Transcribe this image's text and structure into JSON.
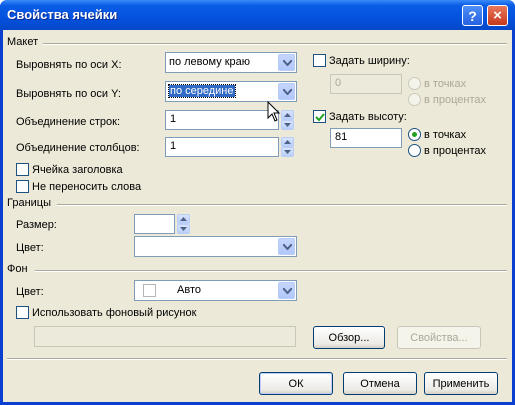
{
  "window": {
    "title": "Свойства ячейки",
    "help_label": "?",
    "close_label": "×"
  },
  "layout_section": {
    "title": "Макет",
    "align_x_label": "Выровнять по оси X:",
    "align_x_value": "по левому краю",
    "align_y_label": "Выровнять по оси Y:",
    "align_y_value": "по середине",
    "rowspan_label": "Объединение строк:",
    "rowspan_value": "1",
    "colspan_label": "Объединение столбцов:",
    "colspan_value": "1",
    "header_cell_label": "Ячейка заголовка",
    "header_cell_checked": false,
    "nowrap_label": "Не переносить слова",
    "nowrap_checked": false,
    "set_width_label": "Задать ширину:",
    "set_width_checked": false,
    "width_value": "0",
    "width_unit_points": "в точках",
    "width_unit_percent": "в процентах",
    "set_height_label": "Задать высоту:",
    "set_height_checked": true,
    "height_value": "81",
    "height_unit_points": "в точках",
    "height_unit_percent": "в процентах",
    "height_unit_selected": "points"
  },
  "borders_section": {
    "title": "Границы",
    "size_label": "Размер:",
    "size_value": "",
    "color_label": "Цвет:",
    "color_value": ""
  },
  "background_section": {
    "title": "Фон",
    "color_label": "Цвет:",
    "color_value": "Авто",
    "use_image_label": "Использовать фоновый рисунок",
    "use_image_checked": false,
    "image_path": "",
    "browse_label": "Обзор...",
    "properties_label": "Свойства..."
  },
  "buttons": {
    "ok": "ОК",
    "cancel": "Отмена",
    "apply": "Применить"
  },
  "colors": {
    "titlebar": "#0553e0",
    "dialog_bg": "#ece9d8",
    "selection": "#316ac5",
    "radio_dot": "#21a121"
  }
}
